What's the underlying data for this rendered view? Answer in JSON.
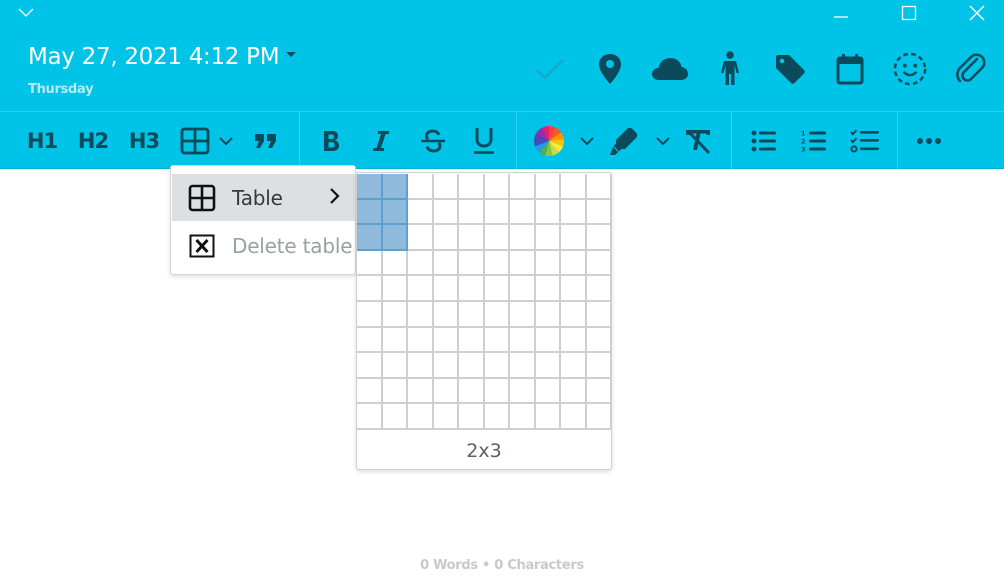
{
  "window": {
    "collapse_icon": "chevron-down-icon",
    "controls": [
      "minimize",
      "maximize",
      "close"
    ]
  },
  "header": {
    "datetime": "May 27, 2021 4:12 PM",
    "weekday": "Thursday",
    "icons": [
      "check-icon",
      "location-pin-icon",
      "cloud-icon",
      "person-icon",
      "tag-icon",
      "calendar-icon",
      "mood-icon",
      "paperclip-icon"
    ]
  },
  "toolbar": {
    "h1": "H1",
    "h2": "H2",
    "h3": "H3",
    "groups": [
      [
        "H1",
        "H2",
        "H3",
        "table-icon",
        "quote-icon"
      ],
      [
        "bold-icon",
        "italic-icon",
        "strikethrough-icon",
        "underline-icon"
      ],
      [
        "text-color-icon",
        "highlight-icon",
        "clear-format-icon"
      ],
      [
        "bullet-list-icon",
        "numbered-list-icon",
        "checklist-icon"
      ],
      [
        "more-icon"
      ]
    ]
  },
  "table_menu": {
    "items": [
      {
        "label": "Table",
        "icon": "table-icon",
        "has_submenu": true,
        "enabled": true
      },
      {
        "label": "Delete table",
        "icon": "delete-table-icon",
        "has_submenu": false,
        "enabled": false
      }
    ]
  },
  "grid_picker": {
    "columns": 10,
    "rows": 10,
    "selected_cols": 2,
    "selected_rows": 3,
    "size_label": "2x3",
    "highlight_color": "#8fbadb"
  },
  "status_bar": {
    "text": "0 Words • 0 Characters"
  },
  "colors": {
    "accent": "#00c3e8",
    "icon": "#0b4a5a"
  }
}
